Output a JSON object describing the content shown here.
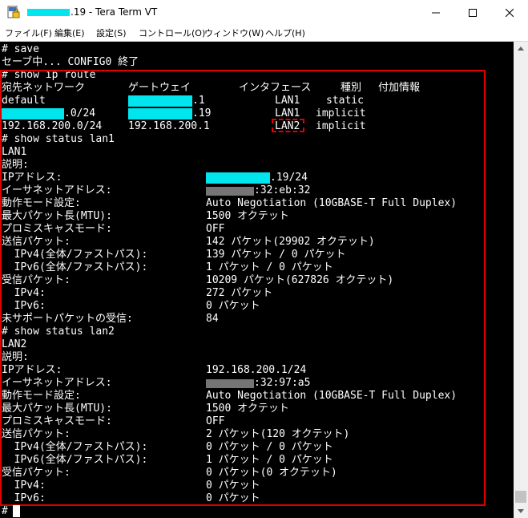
{
  "window": {
    "title": ".19 - Tera Term VT"
  },
  "menu": [
    "ファイル(F)",
    "編集(E)",
    "設定(S)",
    "コントロール(O)",
    "ウィンドウ(W)",
    "ヘルプ(H)"
  ],
  "colors": {
    "terminal_bg": "#000000",
    "terminal_fg": "#ffffff",
    "redaction": "#00e5ee",
    "annotation": "#e00000"
  },
  "icons": {
    "app": "tera-term-lock-icon",
    "minimize": "minimize-icon",
    "maximize": "maximize-icon",
    "close": "close-icon"
  },
  "terminal": {
    "l1": "# save",
    "l2": "セーブ中... CONFIG0 終了",
    "l3": "# show ip route",
    "route_header": {
      "dest": "宛先ネットワーク",
      "gw": "ゲートウェイ",
      "iface": "インタフェース",
      "type": "種別",
      "extra": "付加情報"
    },
    "routes": [
      {
        "dest": "default",
        "gw": ".1",
        "iface": "LAN1",
        "type": "static"
      },
      {
        "dest": ".0/24",
        "gw": ".19",
        "iface": "LAN1",
        "type": "implicit"
      },
      {
        "dest": "192.168.200.0/24",
        "gw": "192.168.200.1",
        "iface": "LAN2",
        "type": "implicit"
      }
    ],
    "lan1": {
      "cmd": "# show status lan1",
      "name": "LAN1",
      "desc_label": "説明:",
      "rows": [
        {
          "label": "IPアドレス:",
          "value": ".19/24"
        },
        {
          "label": "イーサネットアドレス:",
          "value": ":32:eb:32"
        },
        {
          "label": "動作モード設定:",
          "value": "Auto Negotiation (10GBASE-T Full Duplex)"
        },
        {
          "label": "最大パケット長(MTU):",
          "value": "1500 オクテット"
        },
        {
          "label": "プロミスキャスモード:",
          "value": "OFF"
        },
        {
          "label": "送信パケット:",
          "value": "142 パケット(29902 オクテット)"
        },
        {
          "label": "  IPv4(全体/ファストパス):",
          "value": "139 パケット / 0 パケット"
        },
        {
          "label": "  IPv6(全体/ファストパス):",
          "value": "1 パケット / 0 パケット"
        },
        {
          "label": "受信パケット:",
          "value": "10209 パケット(627826 オクテット)"
        },
        {
          "label": "  IPv4:",
          "value": "272 パケット"
        },
        {
          "label": "  IPv6:",
          "value": "0 パケット"
        },
        {
          "label": "未サポートパケットの受信:",
          "value": "84"
        }
      ]
    },
    "lan2": {
      "cmd": "# show status lan2",
      "name": "LAN2",
      "desc_label": "説明:",
      "rows": [
        {
          "label": "IPアドレス:",
          "value": "192.168.200.1/24"
        },
        {
          "label": "イーサネットアドレス:",
          "value": ":32:97:a5"
        },
        {
          "label": "動作モード設定:",
          "value": "Auto Negotiation (10GBASE-T Full Duplex)"
        },
        {
          "label": "最大パケット長(MTU):",
          "value": "1500 オクテット"
        },
        {
          "label": "プロミスキャスモード:",
          "value": "OFF"
        },
        {
          "label": "送信パケット:",
          "value": "2 パケット(120 オクテット)"
        },
        {
          "label": "  IPv4(全体/ファストパス):",
          "value": "0 パケット / 0 パケット"
        },
        {
          "label": "  IPv6(全体/ファストパス):",
          "value": "1 パケット / 0 パケット"
        },
        {
          "label": "受信パケット:",
          "value": "0 パケット(0 オクテット)"
        },
        {
          "label": "  IPv4:",
          "value": "0 パケット"
        },
        {
          "label": "  IPv6:",
          "value": "0 パケット"
        }
      ]
    },
    "prompt": "#"
  }
}
